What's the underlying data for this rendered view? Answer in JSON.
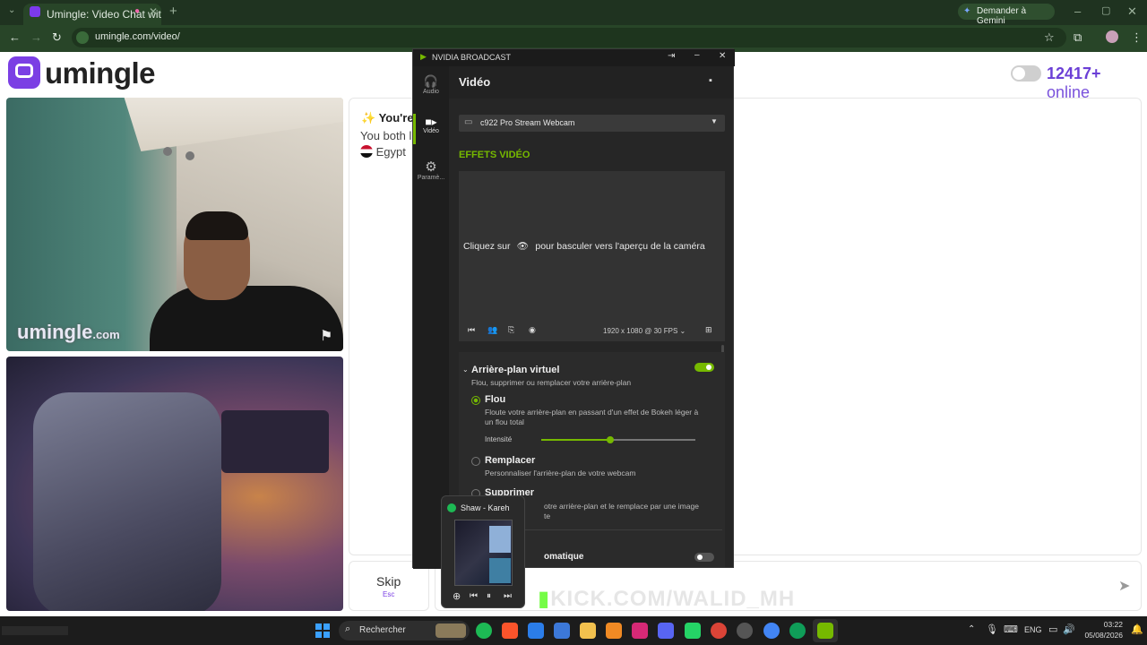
{
  "browser": {
    "tab_title": "Umingle: Video Chat with S",
    "url": "umingle.com/video/",
    "gemini_label": "Demander à Gemini"
  },
  "page": {
    "logo_text": "umingle",
    "online_count": "12417+",
    "online_label": "online",
    "watermark_main": "umingle",
    "watermark_suffix": ".com",
    "chat_intro": "You're",
    "chat_line": "You both l",
    "chat_country": "Egypt",
    "skip_label": "Skip",
    "skip_key": "Esc"
  },
  "nvidia": {
    "app_title": "NVIDIA BROADCAST",
    "nav": [
      {
        "label": "Audio",
        "icon": "headphones-icon"
      },
      {
        "label": "Vidéo",
        "icon": "camera-icon"
      },
      {
        "label": "Paramè...",
        "icon": "gear-icon"
      }
    ],
    "section_title": "Vidéo",
    "device": "c922 Pro Stream Webcam",
    "effects_title": "EFFETS VIDÉO",
    "preview_text_1": "Cliquez sur",
    "preview_text_2": "pour basculer vers l'aperçu de la caméra",
    "resolution": "1920 x 1080 @ 30 FPS",
    "effect_name": "Arrière-plan virtuel",
    "effect_desc": "Flou, supprimer ou remplacer votre arrière-plan",
    "options": [
      {
        "label": "Flou",
        "desc": "Floute votre arrière-plan en passant d'un effet de Bokeh léger à un flou total",
        "selected": true
      },
      {
        "label": "Remplacer",
        "desc": "Personnaliser l'arrière-plan de votre webcam",
        "selected": false
      },
      {
        "label": "Supprimer",
        "desc": "otre arrière-plan et le remplace par une image",
        "desc2": "te",
        "selected": false
      }
    ],
    "intensity_label": "Intensité",
    "intensity": 0.45,
    "bottom_effect": "omatique",
    "accent": "#76b900"
  },
  "spotify": {
    "track": "Shaw - Kareh"
  },
  "overlay": {
    "kick_text": "KICK.COM/WALID_MH"
  },
  "taskbar": {
    "search_placeholder": "Rechercher",
    "language": "ENG",
    "time": "03:22",
    "date": "05/08/2026"
  }
}
